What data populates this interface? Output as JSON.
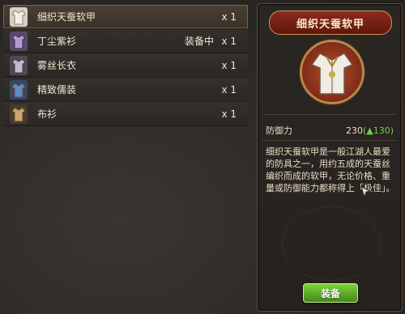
{
  "inventory": {
    "items": [
      {
        "name": "细织天蚕软甲",
        "status": "",
        "qty": "x 1",
        "icon": "robe-white-icon"
      },
      {
        "name": "丁尘紫衫",
        "status": "装备中",
        "qty": "x 1",
        "icon": "robe-purple-icon"
      },
      {
        "name": "雾丝长衣",
        "status": "",
        "qty": "x 1",
        "icon": "robe-grey-icon"
      },
      {
        "name": "精致儒装",
        "status": "",
        "qty": "x 1",
        "icon": "robe-blue-icon"
      },
      {
        "name": "布衫",
        "status": "",
        "qty": "x 1",
        "icon": "robe-brown-icon"
      }
    ]
  },
  "detail": {
    "title": "细织天蚕软甲",
    "stat_label": "防御力",
    "stat_value": "230",
    "stat_bonus": "(▲130)",
    "description": "细织天蚕软甲是一般江湖人最爱的防具之一，用约五成的天蚕丝编织而成的软甲，无论价格、重量或防御能力都称得上「极佳」。",
    "equip_button": "装备"
  },
  "colors": {
    "accent_red": "#8e2a1c",
    "bonus_green": "#6ed04a",
    "button_green": "#5fb22a"
  }
}
